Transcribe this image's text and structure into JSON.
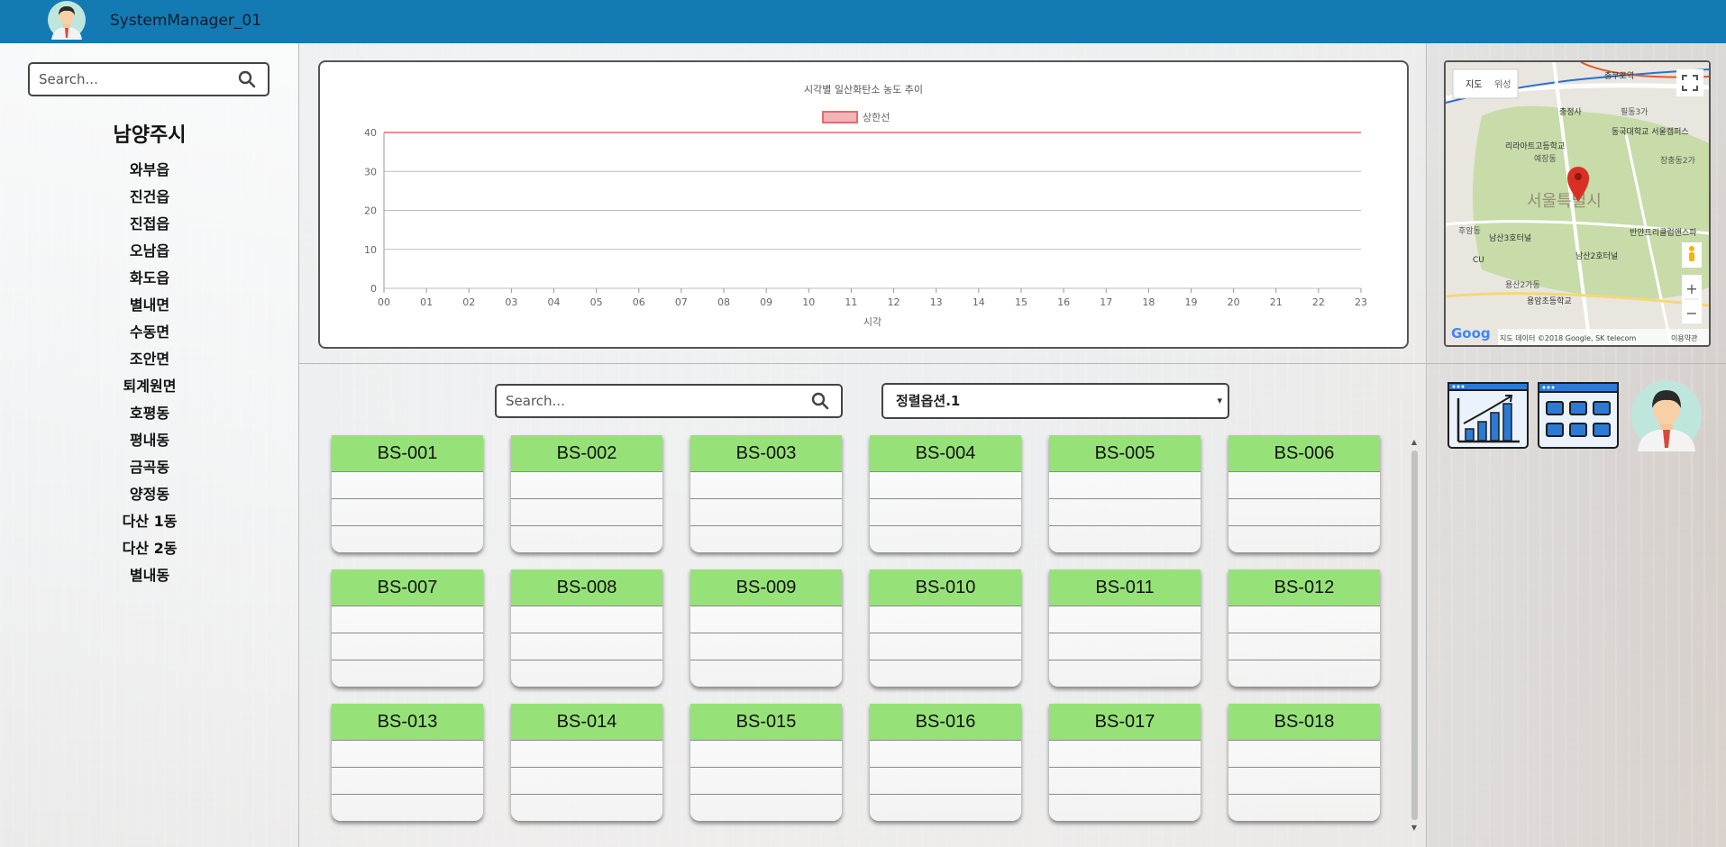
{
  "header": {
    "username": "SystemManager_01"
  },
  "sidebar": {
    "search_placeholder": "Search...",
    "region_title": "남양주시",
    "regions": [
      "와부읍",
      "진건읍",
      "진접읍",
      "오남읍",
      "화도읍",
      "별내면",
      "수동면",
      "조안면",
      "퇴계원면",
      "호평동",
      "평내동",
      "금곡동",
      "양정동",
      "다산 1동",
      "다산 2동",
      "별내동"
    ]
  },
  "chart_data": {
    "type": "line",
    "title": "시각별 일산화탄소 농도 추이",
    "xlabel": "시각",
    "ylabel": "",
    "categories": [
      "00",
      "01",
      "02",
      "03",
      "04",
      "05",
      "06",
      "07",
      "08",
      "09",
      "10",
      "11",
      "12",
      "13",
      "14",
      "15",
      "16",
      "17",
      "18",
      "19",
      "20",
      "21",
      "22",
      "23"
    ],
    "ylim": [
      0,
      40
    ],
    "yticks": [
      0,
      10,
      20,
      30,
      40
    ],
    "series": [
      {
        "name": "상한선",
        "values": [
          40,
          40,
          40,
          40,
          40,
          40,
          40,
          40,
          40,
          40,
          40,
          40,
          40,
          40,
          40,
          40,
          40,
          40,
          40,
          40,
          40,
          40,
          40,
          40
        ]
      }
    ],
    "grid": true,
    "legend": "top-center",
    "colors": {
      "limit_line": "#e36c6c",
      "legend_fill": "#f4b3b8"
    }
  },
  "main": {
    "search_placeholder": "Search...",
    "sort_selected": "정렬옵션.1",
    "stations": [
      "BS-001",
      "BS-002",
      "BS-003",
      "BS-004",
      "BS-005",
      "BS-006",
      "BS-007",
      "BS-008",
      "BS-009",
      "BS-010",
      "BS-011",
      "BS-012",
      "BS-013",
      "BS-014",
      "BS-015",
      "BS-016",
      "BS-017",
      "BS-018"
    ]
  },
  "map": {
    "tab_map": "지도",
    "tab_satellite": "위성",
    "city_label": "서울특별시",
    "labels": [
      "리라아트고등학교",
      "동국대학교 서울캠퍼스",
      "남산3호터널",
      "남산2호터널",
      "반얀트리클럽앤스파",
      "용암초등학교",
      "충정사",
      "예장동",
      "장충동2가",
      "후암동",
      "용산2가동",
      "필동3가",
      "충무로역",
      "CU"
    ],
    "attribution": "지도 데이터 ©2018 Google, SK telecom",
    "terms": "이용약관",
    "zoom_in": "+",
    "zoom_out": "−"
  },
  "icons": [
    "chart-growth-icon",
    "dashboard-grid-icon",
    "user-avatar-icon"
  ],
  "colors": {
    "topbar": "#137ab4",
    "card_header": "#96e279"
  }
}
